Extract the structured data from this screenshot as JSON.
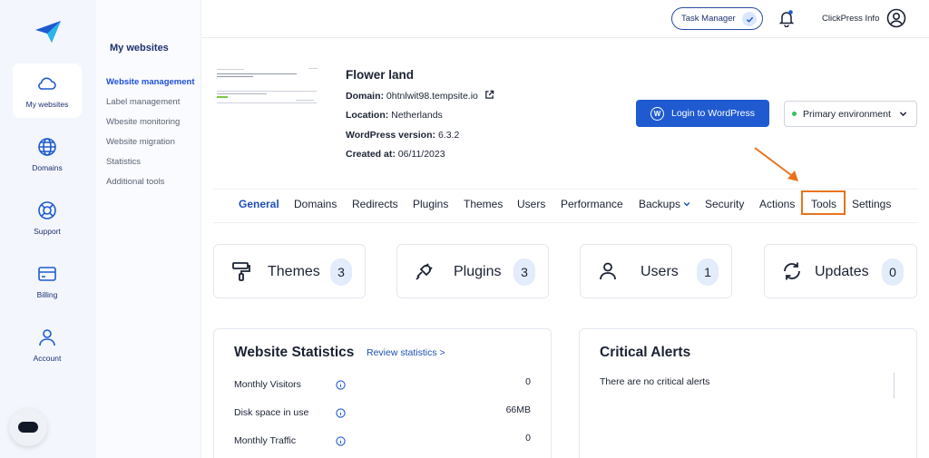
{
  "colors": {
    "accent": "#1f5ad1",
    "highlight": "#e8731d",
    "rail_bg": "#f3f6fd"
  },
  "rail": {
    "logo_icon": "paper-plane-logo",
    "items": [
      {
        "label": "My websites",
        "icon": "cloud-icon"
      },
      {
        "label": "Domains",
        "icon": "globe-icon"
      },
      {
        "label": "Support",
        "icon": "lifebuoy-icon"
      },
      {
        "label": "Billing",
        "icon": "card-icon"
      },
      {
        "label": "Account",
        "icon": "user-icon"
      }
    ]
  },
  "subnav": {
    "title": "My websites",
    "items": [
      {
        "label": "Website management"
      },
      {
        "label": "Label management"
      },
      {
        "label": "Wbesite monitoring"
      },
      {
        "label": "Website migration"
      },
      {
        "label": "Statistics"
      },
      {
        "label": "Additional tools"
      }
    ]
  },
  "topbar": {
    "task_manager": "Task Manager",
    "account_name": "ClickPress Info"
  },
  "site": {
    "title": "Flower land",
    "domain_label": "Domain:",
    "domain": "0htnlwit98.tempsite.io",
    "location_label": "Location:",
    "location": "Netherlands",
    "wp_label": "WordPress version:",
    "wp_version": "6.3.2",
    "created_label": "Created at:",
    "created": "06/11/2023",
    "login_button": "Login to WordPress",
    "environment": "Primary environment"
  },
  "tabs": [
    "General",
    "Domains",
    "Redirects",
    "Plugins",
    "Themes",
    "Users",
    "Performance",
    "Backups",
    "Security",
    "Actions",
    "Tools",
    "Settings"
  ],
  "cards": [
    {
      "label": "Themes",
      "count": "3",
      "icon": "paint-roller-icon"
    },
    {
      "label": "Plugins",
      "count": "3",
      "icon": "plug-icon"
    },
    {
      "label": "Users",
      "count": "1",
      "icon": "user-icon"
    },
    {
      "label": "Updates",
      "count": "0",
      "icon": "refresh-icon"
    }
  ],
  "stats": {
    "title": "Website Statistics",
    "review": "Review statistics >",
    "rows": [
      {
        "label": "Monthly Visitors",
        "value": "0"
      },
      {
        "label": "Disk space in use",
        "value": "66MB"
      },
      {
        "label": "Monthly Traffic",
        "value": "0"
      }
    ]
  },
  "alerts": {
    "title": "Critical Alerts",
    "empty": "There are no critical alerts"
  }
}
